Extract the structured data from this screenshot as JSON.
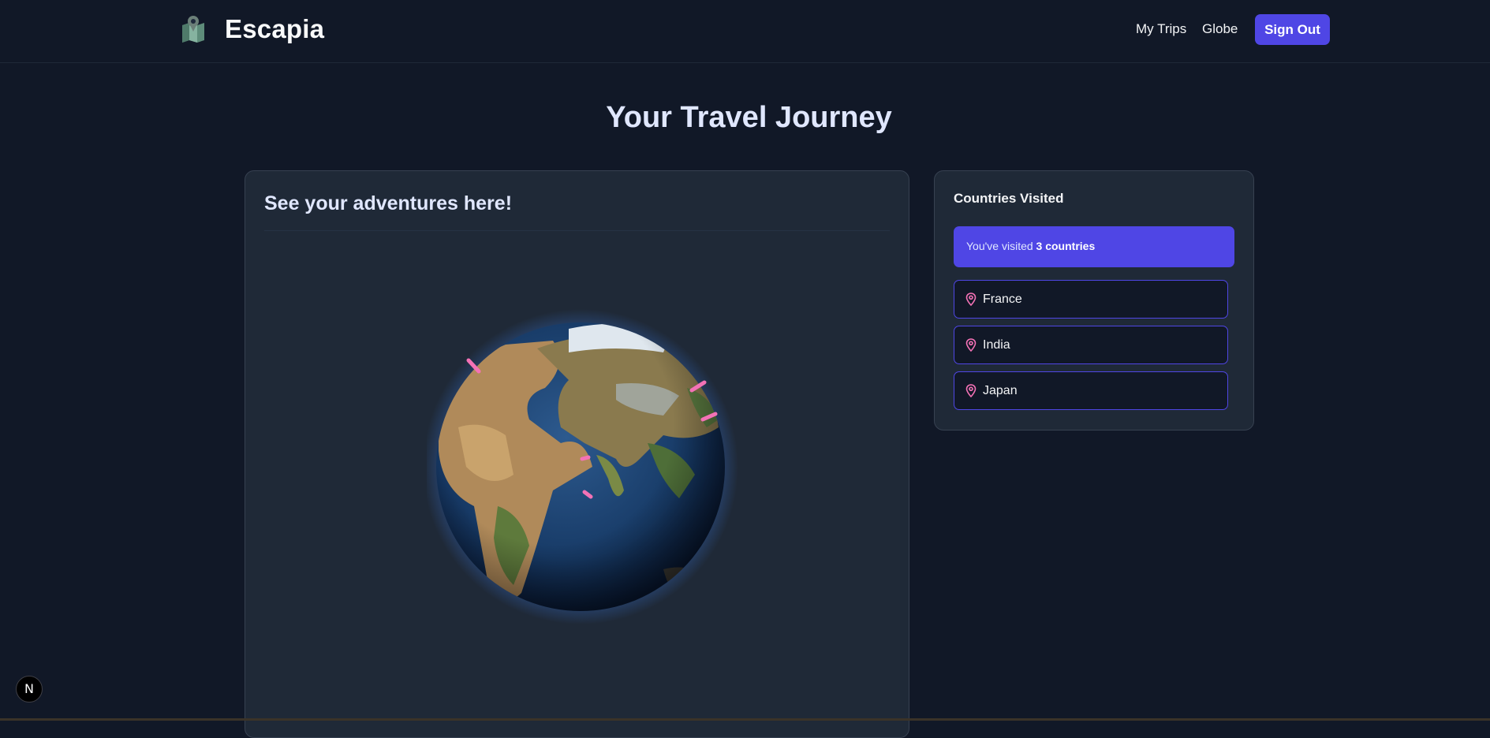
{
  "header": {
    "brand": "Escapia",
    "logo_icon": "folded-map-pin-icon",
    "nav": [
      {
        "label": "My Trips"
      },
      {
        "label": "Globe"
      }
    ],
    "signout_label": "Sign Out",
    "accent_color": "#4f46e5"
  },
  "main": {
    "title": "Your Travel Journey",
    "globe_card": {
      "title": "See your adventures here!",
      "globe_icon": "earth-globe-icon",
      "marker_color": "#f472b6"
    },
    "countries_card": {
      "title": "Countries Visited",
      "visited_prefix": "You've visited ",
      "visited_count": "3 countries",
      "pin_icon": "map-pin-icon",
      "countries": [
        {
          "name": "France"
        },
        {
          "name": "India"
        },
        {
          "name": "Japan"
        }
      ]
    }
  },
  "dev_badge": {
    "label": "N",
    "icon": "nextjs-logo-icon"
  }
}
